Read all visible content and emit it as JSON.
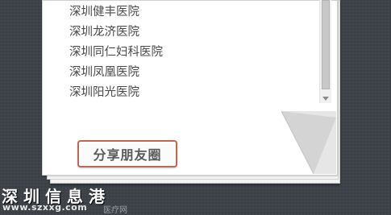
{
  "hospital_list": {
    "items": [
      "深圳健丰医院",
      "深圳龙济医院",
      "深圳同仁妇科医院",
      "深圳凤凰医院",
      "深圳阳光医院"
    ]
  },
  "share_button": {
    "label": "分享朋友圈"
  },
  "watermark": {
    "title": "深圳信息港",
    "url": "www.szxxg.com",
    "subtitle": "医疗网"
  },
  "colors": {
    "background": "#3c4147",
    "button_border": "#b86a55",
    "text": "#4a4a4a"
  },
  "icons": [
    "scroll-down-arrow-icon",
    "page-curl-icon"
  ]
}
